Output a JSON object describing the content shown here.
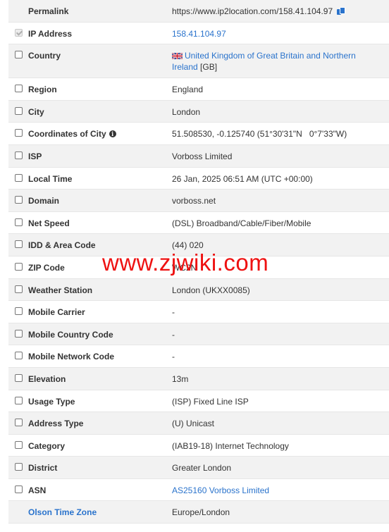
{
  "rows": [
    {
      "key": "permalink",
      "label": "Permalink",
      "value": "https://www.ip2location.com/158.41.104.97",
      "checkbox": "none",
      "copy": true
    },
    {
      "key": "ip",
      "label": "IP Address",
      "value": "158.41.104.97",
      "checkbox": "checked-disabled",
      "value_link": true
    },
    {
      "key": "country",
      "label": "Country",
      "value_link_text": "United Kingdom of Great Britain and Northern Ireland",
      "value_suffix": "[GB]",
      "checkbox": "unchecked",
      "flag": "uk-flag"
    },
    {
      "key": "region",
      "label": "Region",
      "value": "England",
      "checkbox": "unchecked"
    },
    {
      "key": "city",
      "label": "City",
      "value": "London",
      "checkbox": "unchecked"
    },
    {
      "key": "coordinates",
      "label": "Coordinates of City",
      "value": "51.508530, -0.125740 (51°30'31\"N   0°7'33\"W)",
      "checkbox": "unchecked",
      "info": true
    },
    {
      "key": "isp",
      "label": "ISP",
      "value": "Vorboss Limited",
      "checkbox": "unchecked"
    },
    {
      "key": "local_time",
      "label": "Local Time",
      "value": "26 Jan, 2025 06:51 AM (UTC +00:00)",
      "checkbox": "unchecked"
    },
    {
      "key": "domain",
      "label": "Domain",
      "value": "vorboss.net",
      "checkbox": "unchecked"
    },
    {
      "key": "net_speed",
      "label": "Net Speed",
      "value": "(DSL) Broadband/Cable/Fiber/Mobile",
      "checkbox": "unchecked"
    },
    {
      "key": "idd",
      "label": "IDD & Area Code",
      "value": "(44) 020",
      "checkbox": "unchecked"
    },
    {
      "key": "zip",
      "label": "ZIP Code",
      "value": "WC2N",
      "checkbox": "unchecked"
    },
    {
      "key": "weather",
      "label": "Weather Station",
      "value": "London (UKXX0085)",
      "checkbox": "unchecked"
    },
    {
      "key": "mobile_carrier",
      "label": "Mobile Carrier",
      "value": "-",
      "checkbox": "unchecked"
    },
    {
      "key": "mcc",
      "label": "Mobile Country Code",
      "value": "-",
      "checkbox": "unchecked"
    },
    {
      "key": "mnc",
      "label": "Mobile Network Code",
      "value": "-",
      "checkbox": "unchecked"
    },
    {
      "key": "elevation",
      "label": "Elevation",
      "value": "13m",
      "checkbox": "unchecked"
    },
    {
      "key": "usage_type",
      "label": "Usage Type",
      "value": "(ISP) Fixed Line ISP",
      "checkbox": "unchecked"
    },
    {
      "key": "address_type",
      "label": "Address Type",
      "value": "(U) Unicast",
      "checkbox": "unchecked"
    },
    {
      "key": "category",
      "label": "Category",
      "value": "(IAB19-18) Internet Technology",
      "checkbox": "unchecked"
    },
    {
      "key": "district",
      "label": "District",
      "value": "Greater London",
      "checkbox": "unchecked"
    },
    {
      "key": "asn",
      "label": "ASN",
      "value": "AS25160 Vorboss Limited",
      "checkbox": "unchecked",
      "value_link": true
    },
    {
      "key": "olson",
      "label": "Olson Time Zone",
      "value": "Europe/London",
      "checkbox": "none",
      "label_link": true
    }
  ],
  "watermark": "www.zjwiki.com",
  "colors": {
    "link": "#2a73cc",
    "watermark": "#ee1111",
    "stripe": "#f2f2f2"
  }
}
